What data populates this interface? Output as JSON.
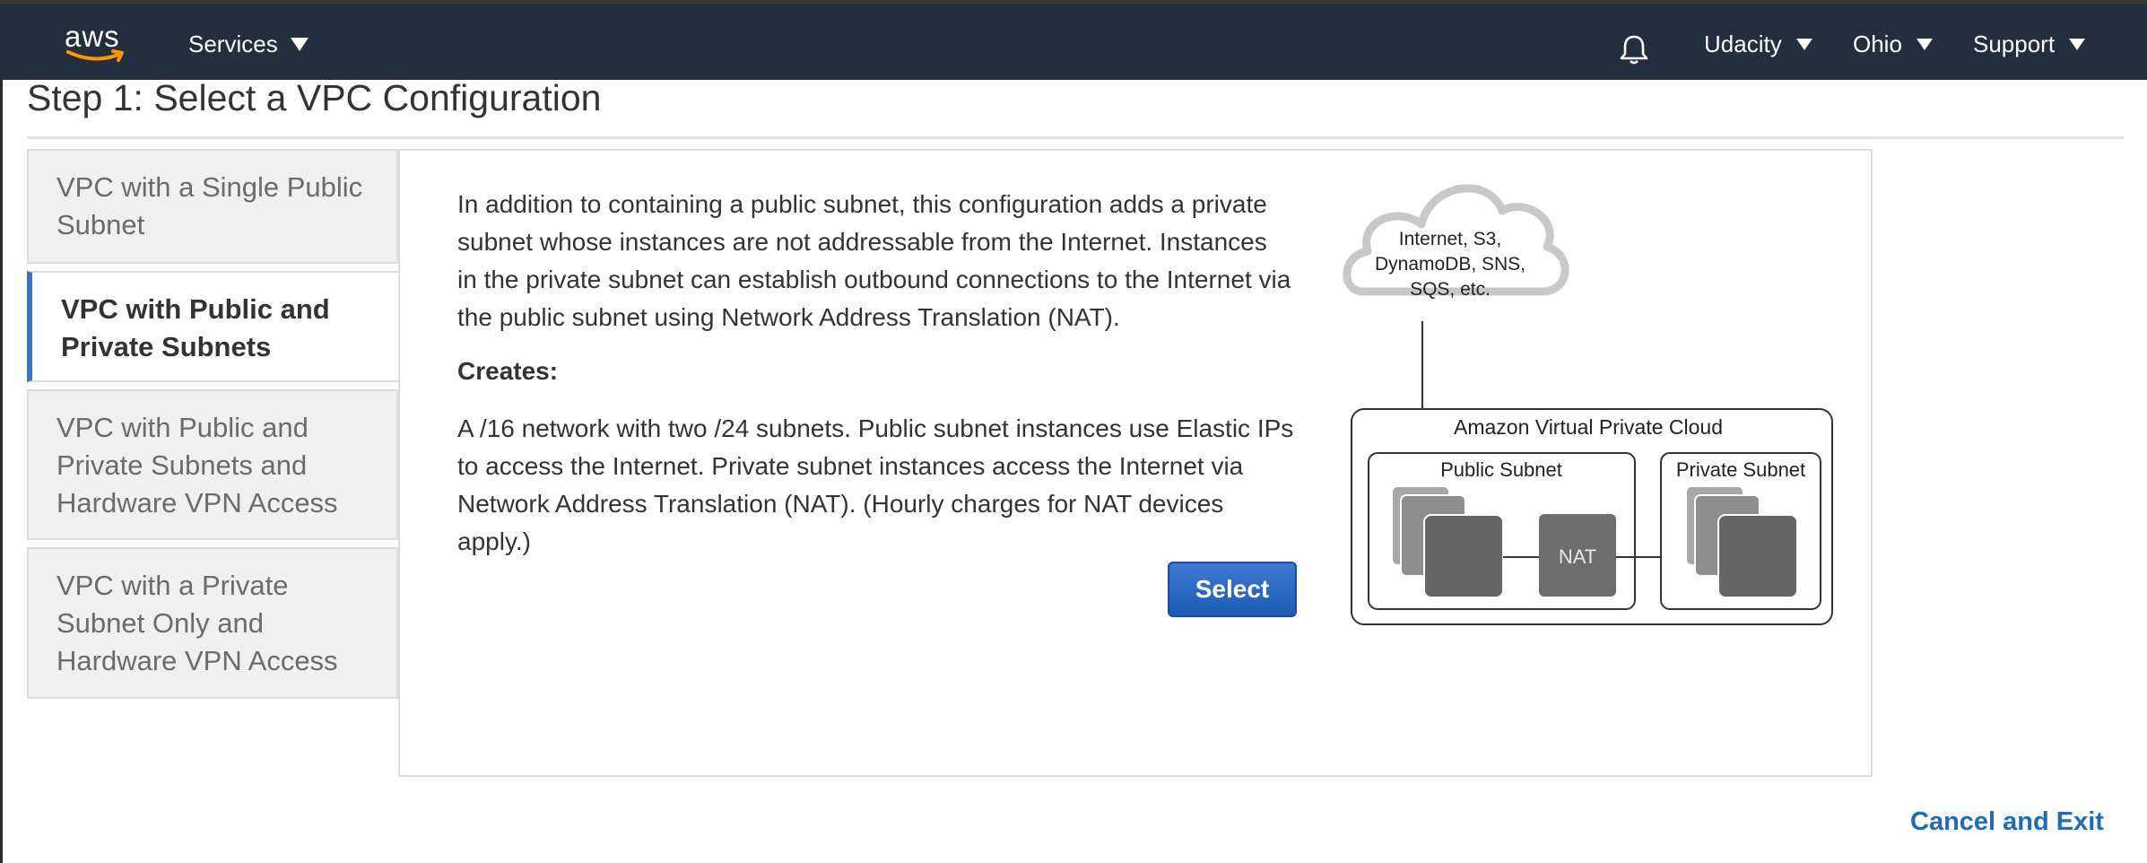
{
  "topnav": {
    "logo_text": "aws",
    "services_label": "Services",
    "account_label": "Udacity",
    "region_label": "Ohio",
    "support_label": "Support",
    "icons": [
      "aws-logo",
      "bell-icon",
      "caret-down-icon"
    ]
  },
  "page": {
    "title": "Step 1: Select a VPC Configuration"
  },
  "tabs": [
    {
      "label": "VPC with a Single Public Subnet",
      "active": false
    },
    {
      "label": "VPC with Public and Private Subnets",
      "active": true
    },
    {
      "label": "VPC with Public and Private Subnets and Hardware VPN Access",
      "active": false
    },
    {
      "label": "VPC with a Private Subnet Only and Hardware VPN Access",
      "active": false
    }
  ],
  "content": {
    "description": "In addition to containing a public subnet, this configuration adds a private subnet whose instances are not addressable from the Internet. Instances in the private subnet can establish outbound connections to the Internet via the public subnet using Network Address Translation (NAT).",
    "creates_label": "Creates:",
    "creates_description": "A /16 network with two /24 subnets. Public subnet instances use Elastic IPs to access the Internet. Private subnet instances access the Internet via Network Address Translation (NAT). (Hourly charges for NAT devices apply.)",
    "select_button": "Select"
  },
  "diagram": {
    "cloud_line1": "Internet, S3,",
    "cloud_line2": "DynamoDB, SNS,",
    "cloud_line3": "SQS, etc.",
    "vpc_label": "Amazon Virtual Private Cloud",
    "public_subnet_label": "Public Subnet",
    "private_subnet_label": "Private Subnet",
    "nat_label": "NAT"
  },
  "footer": {
    "cancel_label": "Cancel and Exit"
  },
  "colors": {
    "nav_bg": "#232f3e",
    "active_tab_accent": "#3b73c4",
    "select_button": "#1d5bb3",
    "link": "#1e6bb8"
  }
}
